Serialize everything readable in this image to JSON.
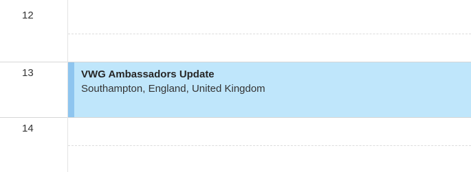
{
  "time_gutter": {
    "hours": [
      "12",
      "13",
      "14"
    ]
  },
  "event": {
    "title": "VWG Ambassadors Update",
    "location": "Southampton, England, United Kingdom",
    "color": "#bfe6fb",
    "accent_color": "#8ec5ef"
  }
}
